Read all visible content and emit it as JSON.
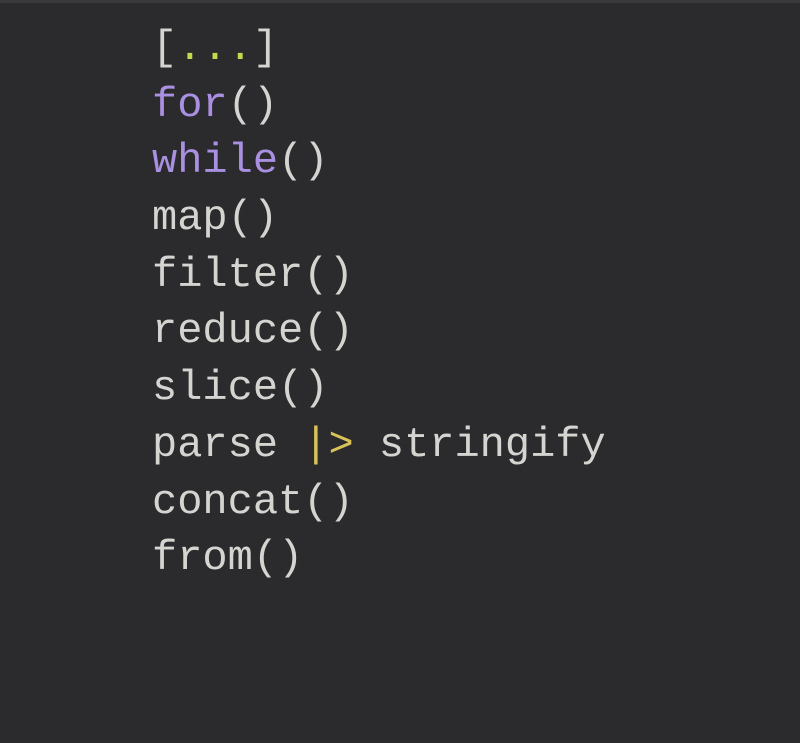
{
  "lines": {
    "l1": {
      "open": "[",
      "dots": "...",
      "close": "]"
    },
    "l2": {
      "kw": "for",
      "parens": "()"
    },
    "l3": {
      "kw": "while",
      "parens": "()"
    },
    "l4": {
      "fn": "map",
      "parens": "()"
    },
    "l5": {
      "fn": "filter",
      "parens": "()"
    },
    "l6": {
      "fn": "reduce",
      "parens": "()"
    },
    "l7": {
      "fn": "slice",
      "parens": "()"
    },
    "l8": {
      "left": "parse ",
      "pipe": "|>",
      "right": " stringify"
    },
    "l9": {
      "fn": "concat",
      "parens": "()"
    },
    "l10": {
      "fn": "from",
      "parens": "()"
    }
  }
}
